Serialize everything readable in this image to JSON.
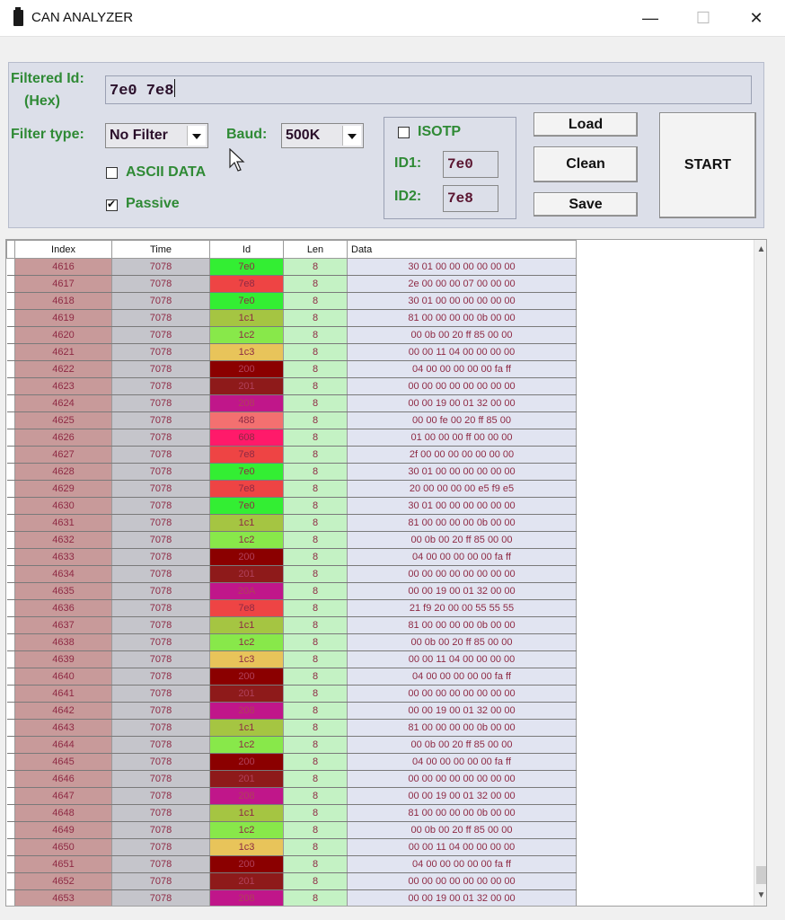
{
  "window": {
    "title": "CAN ANALYZER",
    "min_glyph": "—",
    "max_glyph": "☐",
    "close_glyph": "✕"
  },
  "controls": {
    "filtered_id_label_1": "Filtered Id:",
    "filtered_id_label_2": "(Hex)",
    "filtered_id_value": "7e0 7e8",
    "filter_type_label": "Filter type:",
    "filter_type_value": "No Filter",
    "baud_label": "Baud:",
    "baud_value": "500K",
    "ascii_data_label": "ASCII DATA",
    "ascii_data_checked": false,
    "passive_label": "Passive",
    "passive_checked": true,
    "isotp_label": "ISOTP",
    "isotp_checked": false,
    "id1_label": "ID1:",
    "id1_value": "7e0",
    "id2_label": "ID2:",
    "id2_value": "7e8",
    "load_label": "Load",
    "clean_label": "Clean",
    "save_label": "Save",
    "start_label": "START"
  },
  "colors": {
    "label_green": "#2f8a35",
    "panel_bg": "#dcdfe9",
    "index_col": "#c89a9a",
    "time_col": "#c5c5cb",
    "len_col": "#c4f2c4",
    "data_col": "#e1e4f1"
  },
  "icons": {
    "app": "app-icon",
    "cursor": "mouse-pointer-icon",
    "scroll_up": "chevron-up-icon",
    "scroll_down": "chevron-down-icon"
  },
  "grid": {
    "columns": [
      "Index",
      "Time",
      "Id",
      "Len",
      "Data"
    ],
    "id_colors": {
      "7e0": "#33ee33",
      "7e8": "#ee4444",
      "1c1": "#a5c542",
      "1c2": "#88e84a",
      "1c3": "#e8c45a",
      "200": "#8b0000",
      "201": "#8e1a1a",
      "208": "#c0168a",
      "20A": "#c0168a",
      "488": "#f37070",
      "608": "#ff1a6a"
    },
    "rows": [
      {
        "index": "4616",
        "time": "7078",
        "id": "7e0",
        "len": "8",
        "data": "30 01 00 00 00 00 00 00"
      },
      {
        "index": "4617",
        "time": "7078",
        "id": "7e8",
        "len": "8",
        "data": "2e 00 00 00 07 00 00 00"
      },
      {
        "index": "4618",
        "time": "7078",
        "id": "7e0",
        "len": "8",
        "data": "30 01 00 00 00 00 00 00"
      },
      {
        "index": "4619",
        "time": "7078",
        "id": "1c1",
        "len": "8",
        "data": "81 00 00 00 00 0b 00 00"
      },
      {
        "index": "4620",
        "time": "7078",
        "id": "1c2",
        "len": "8",
        "data": "00 0b 00 20 ff 85 00 00"
      },
      {
        "index": "4621",
        "time": "7078",
        "id": "1c3",
        "len": "8",
        "data": "00 00 11 04 00 00 00 00"
      },
      {
        "index": "4622",
        "time": "7078",
        "id": "200",
        "len": "8",
        "data": "04 00 00 00 00 00 fa ff"
      },
      {
        "index": "4623",
        "time": "7078",
        "id": "201",
        "len": "8",
        "data": "00 00 00 00 00 00 00 00"
      },
      {
        "index": "4624",
        "time": "7078",
        "id": "208",
        "len": "8",
        "data": "00 00 19 00 01 32 00 00"
      },
      {
        "index": "4625",
        "time": "7078",
        "id": "488",
        "len": "8",
        "data": "00 00 fe 00 20 ff 85 00"
      },
      {
        "index": "4626",
        "time": "7078",
        "id": "608",
        "len": "8",
        "data": "01 00 00 00 ff 00 00 00"
      },
      {
        "index": "4627",
        "time": "7078",
        "id": "7e8",
        "len": "8",
        "data": "2f 00 00 00 00 00 00 00"
      },
      {
        "index": "4628",
        "time": "7078",
        "id": "7e0",
        "len": "8",
        "data": "30 01 00 00 00 00 00 00"
      },
      {
        "index": "4629",
        "time": "7078",
        "id": "7e8",
        "len": "8",
        "data": "20 00 00 00 00 e5 f9 e5"
      },
      {
        "index": "4630",
        "time": "7078",
        "id": "7e0",
        "len": "8",
        "data": "30 01 00 00 00 00 00 00"
      },
      {
        "index": "4631",
        "time": "7078",
        "id": "1c1",
        "len": "8",
        "data": "81 00 00 00 00 0b 00 00"
      },
      {
        "index": "4632",
        "time": "7078",
        "id": "1c2",
        "len": "8",
        "data": "00 0b 00 20 ff 85 00 00"
      },
      {
        "index": "4633",
        "time": "7078",
        "id": "200",
        "len": "8",
        "data": "04 00 00 00 00 00 fa ff"
      },
      {
        "index": "4634",
        "time": "7078",
        "id": "201",
        "len": "8",
        "data": "00 00 00 00 00 00 00 00"
      },
      {
        "index": "4635",
        "time": "7078",
        "id": "20A",
        "len": "8",
        "data": "00 00 19 00 01 32 00 00"
      },
      {
        "index": "4636",
        "time": "7078",
        "id": "7e8",
        "len": "8",
        "data": "21 f9 20 00 00 55 55 55"
      },
      {
        "index": "4637",
        "time": "7078",
        "id": "1c1",
        "len": "8",
        "data": "81 00 00 00 00 0b 00 00"
      },
      {
        "index": "4638",
        "time": "7078",
        "id": "1c2",
        "len": "8",
        "data": "00 0b 00 20 ff 85 00 00"
      },
      {
        "index": "4639",
        "time": "7078",
        "id": "1c3",
        "len": "8",
        "data": "00 00 11 04 00 00 00 00"
      },
      {
        "index": "4640",
        "time": "7078",
        "id": "200",
        "len": "8",
        "data": "04 00 00 00 00 00 fa ff"
      },
      {
        "index": "4641",
        "time": "7078",
        "id": "201",
        "len": "8",
        "data": "00 00 00 00 00 00 00 00"
      },
      {
        "index": "4642",
        "time": "7078",
        "id": "208",
        "len": "8",
        "data": "00 00 19 00 01 32 00 00"
      },
      {
        "index": "4643",
        "time": "7078",
        "id": "1c1",
        "len": "8",
        "data": "81 00 00 00 00 0b 00 00"
      },
      {
        "index": "4644",
        "time": "7078",
        "id": "1c2",
        "len": "8",
        "data": "00 0b 00 20 ff 85 00 00"
      },
      {
        "index": "4645",
        "time": "7078",
        "id": "200",
        "len": "8",
        "data": "04 00 00 00 00 00 fa ff"
      },
      {
        "index": "4646",
        "time": "7078",
        "id": "201",
        "len": "8",
        "data": "00 00 00 00 00 00 00 00"
      },
      {
        "index": "4647",
        "time": "7078",
        "id": "208",
        "len": "8",
        "data": "00 00 19 00 01 32 00 00"
      },
      {
        "index": "4648",
        "time": "7078",
        "id": "1c1",
        "len": "8",
        "data": "81 00 00 00 00 0b 00 00"
      },
      {
        "index": "4649",
        "time": "7078",
        "id": "1c2",
        "len": "8",
        "data": "00 0b 00 20 ff 85 00 00"
      },
      {
        "index": "4650",
        "time": "7078",
        "id": "1c3",
        "len": "8",
        "data": "00 00 11 04 00 00 00 00"
      },
      {
        "index": "4651",
        "time": "7078",
        "id": "200",
        "len": "8",
        "data": "04 00 00 00 00 00 fa ff"
      },
      {
        "index": "4652",
        "time": "7078",
        "id": "201",
        "len": "8",
        "data": "00 00 00 00 00 00 00 00"
      },
      {
        "index": "4653",
        "time": "7078",
        "id": "208",
        "len": "8",
        "data": "00 00 19 00 01 32 00 00"
      }
    ]
  }
}
